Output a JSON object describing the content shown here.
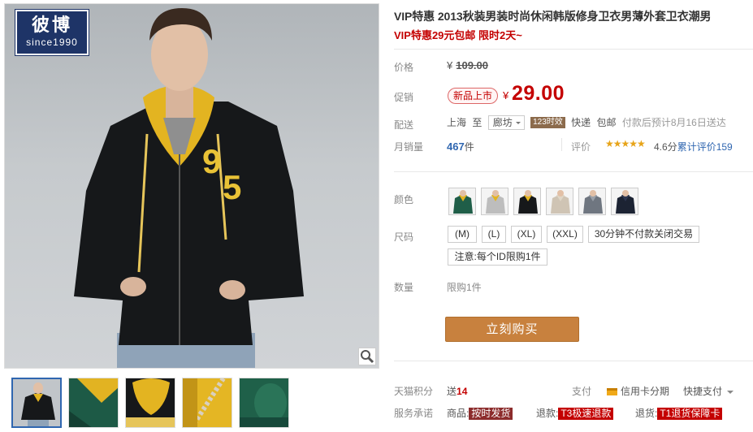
{
  "brand": {
    "name_zh": "彼博",
    "name_en": "since1990"
  },
  "product": {
    "title": "VIP特惠 2013秋装男装时尚休闲韩版修身卫衣男薄外套卫衣潮男",
    "subtitle": "VIP特惠29元包邮 限时2天~"
  },
  "pricing": {
    "list_label": "价格",
    "currency": "¥",
    "list_price": "109.00",
    "promo_label": "促销",
    "promo_tag": "新品上市",
    "promo_price": "29.00"
  },
  "shipping": {
    "label": "配送",
    "from": "上海",
    "to_word": "至",
    "destination": "廊坊",
    "badge": "123时效",
    "method": "快递",
    "cost": "包邮",
    "note": "付款后预计8月16日送达"
  },
  "sales": {
    "label": "月销量",
    "count": "467",
    "unit": "件",
    "reviews_label": "评价",
    "stars": "★★★★★",
    "score": "4.6分",
    "total_reviews": "累计评价159"
  },
  "options": {
    "color_label": "颜色",
    "colors": [
      "green-yellow-hoodie",
      "grey-yellow-hoodie",
      "black-yellow-hoodie",
      "beige-hoodie",
      "grey-hoodie",
      "navy-hoodie"
    ],
    "size_label": "尺码",
    "sizes": [
      "(M)",
      "(L)",
      "(XL)",
      "(XXL)",
      "30分钟不付款关闭交易",
      "注意:每个ID限购1件"
    ],
    "quantity_label": "数量",
    "quantity_note": "限购1件"
  },
  "actions": {
    "buy_now": "立刻购买"
  },
  "extras": {
    "points_label": "天猫积分",
    "points_prefix": "送",
    "points_value": "14",
    "pay_label": "支付",
    "card_pay": "信用卡分期",
    "quick_pay": "快捷支付",
    "service_label": "服务承诺",
    "goods_label": "商品:",
    "goods_tag": "按时发货",
    "refund_label": "退款:",
    "refund_tag": "T3极速退款",
    "return_label": "退货:",
    "return_tag": "T1退货保障卡"
  },
  "colors": {
    "accent_red": "#c40000",
    "buy_button": "#c8813e",
    "link_blue": "#2f66b0",
    "brand_navy": "#1e3467"
  }
}
